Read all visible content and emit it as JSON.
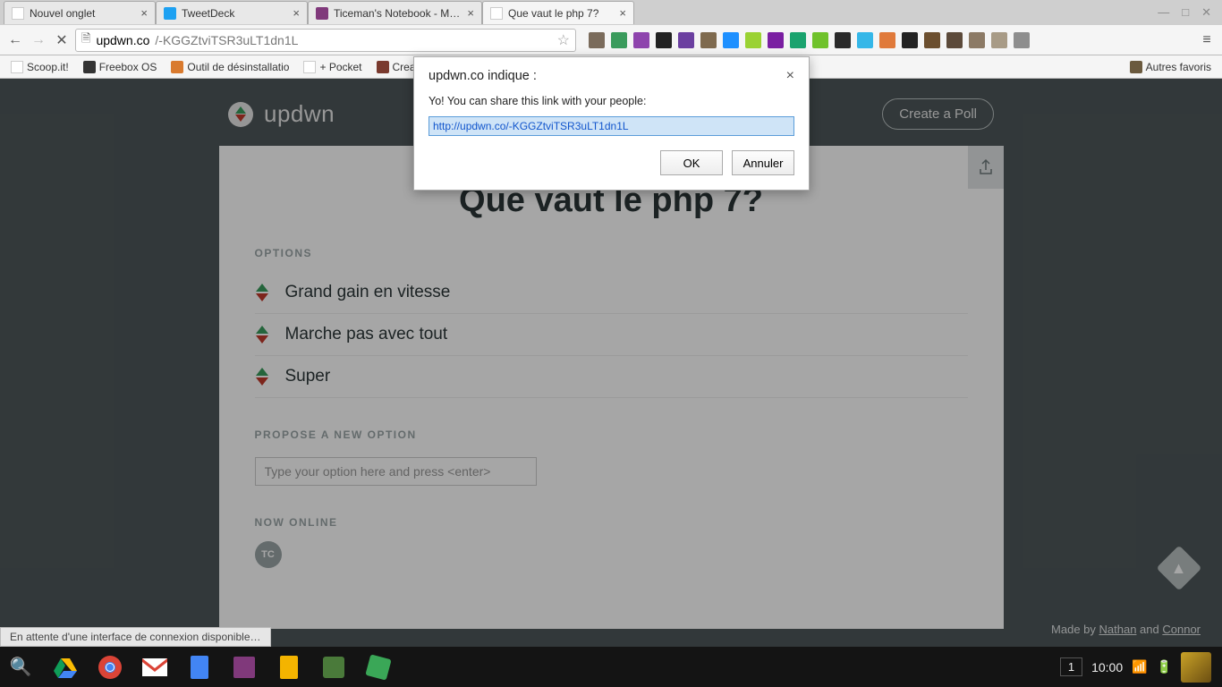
{
  "tabs": [
    {
      "title": "Nouvel onglet",
      "favicon": "blank"
    },
    {
      "title": "TweetDeck",
      "favicon": "tweetdeck"
    },
    {
      "title": "Ticeman's Notebook - Mi…",
      "favicon": "onenote"
    },
    {
      "title": "Que vaut le php 7?",
      "favicon": "blank",
      "active": true
    }
  ],
  "url": {
    "domain": "updwn.co",
    "path": "/-KGGZtviTSR3uLT1dn1L"
  },
  "bookmarks": [
    {
      "label": "Scoop.it!"
    },
    {
      "label": "Freebox OS"
    },
    {
      "label": "Outil de désinstallatio"
    },
    {
      "label": "+ Pocket"
    },
    {
      "label": "Creat…"
    }
  ],
  "bookmarks_right": {
    "label": "Autres favoris"
  },
  "logo_text": "updwn",
  "create_poll": "Create a Poll",
  "poll_title": "Que vaut le php 7?",
  "section_options": "OPTIONS",
  "options": [
    "Grand gain en vitesse",
    "Marche pas avec tout",
    "Super"
  ],
  "section_propose": "PROPOSE A NEW OPTION",
  "propose_placeholder": "Type your option here and press <enter>",
  "section_online": "NOW ONLINE",
  "online_user": "TC",
  "credits": {
    "prefix": "Made by ",
    "a1": "Nathan",
    "mid": " and ",
    "a2": "Connor"
  },
  "dialog": {
    "title": "updwn.co indique :",
    "message": "Yo! You can share this link with your people:",
    "value": "http://updwn.co/-KGGZtviTSR3uLT1dn1L",
    "ok": "OK",
    "cancel": "Annuler"
  },
  "status_bar": "En attente d'une interface de connexion disponible…",
  "systray": {
    "num": "1",
    "time": "10:00"
  },
  "ext_colors": [
    "#7a6b5b",
    "#3a9b5c",
    "#8e44ad",
    "#222",
    "#6b3fa0",
    "#7f6a4e",
    "#1e90ff",
    "#9ad233",
    "#7a1fa2",
    "#1aa36e",
    "#6fc22b",
    "#2a2a2a",
    "#35b7e8",
    "#e07a3b",
    "#222",
    "#6b4e2e",
    "#5c4a3a",
    "#8c7a65",
    "#a89b86",
    "#8e8e8e"
  ]
}
